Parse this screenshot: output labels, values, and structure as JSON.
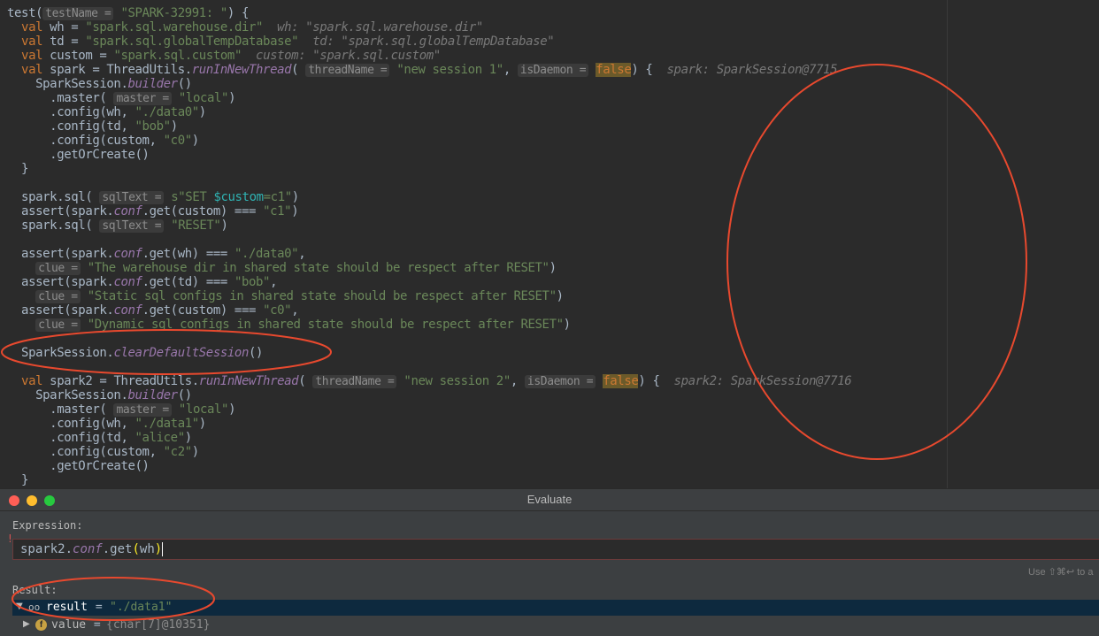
{
  "editor": {
    "lines": [
      [
        [
          "t",
          "test("
        ],
        [
          "h",
          "testName ="
        ],
        [
          "s",
          " \"SPARK-32991: \""
        ],
        [
          "t",
          ") {"
        ]
      ],
      [
        [
          "k",
          "  val"
        ],
        [
          "t",
          " wh = "
        ],
        [
          "s",
          "\"spark.sql.warehouse.dir\""
        ],
        [
          "i",
          "  wh: \"spark.sql.warehouse.dir\""
        ]
      ],
      [
        [
          "k",
          "  val"
        ],
        [
          "t",
          " td = "
        ],
        [
          "s",
          "\"spark.sql.globalTempDatabase\""
        ],
        [
          "i",
          "  td: \"spark.sql.globalTempDatabase\""
        ]
      ],
      [
        [
          "k",
          "  val"
        ],
        [
          "t",
          " custom = "
        ],
        [
          "s",
          "\"spark.sql.custom\""
        ],
        [
          "i",
          "  custom: \"spark.sql.custom\""
        ]
      ],
      [
        [
          "k",
          "  val"
        ],
        [
          "t",
          " spark = ThreadUtils."
        ],
        [
          "m",
          "runInNewThread"
        ],
        [
          "t",
          "( "
        ],
        [
          "h",
          "threadName ="
        ],
        [
          "s",
          " \"new session 1\""
        ],
        [
          "t",
          ", "
        ],
        [
          "h",
          "isDaemon ="
        ],
        [
          "t",
          " "
        ],
        [
          "fv",
          "false"
        ],
        [
          "t",
          ") {"
        ],
        [
          "i",
          "  spark: SparkSession@7715"
        ]
      ],
      [
        [
          "t",
          "    SparkSession."
        ],
        [
          "m",
          "builder"
        ],
        [
          "t",
          "()"
        ]
      ],
      [
        [
          "t",
          "      .master( "
        ],
        [
          "h",
          "master ="
        ],
        [
          "s",
          " \"local\""
        ],
        [
          "t",
          ")"
        ]
      ],
      [
        [
          "t",
          "      .config(wh, "
        ],
        [
          "s",
          "\"./data0\""
        ],
        [
          "t",
          ")"
        ]
      ],
      [
        [
          "t",
          "      .config(td, "
        ],
        [
          "s",
          "\"bob\""
        ],
        [
          "t",
          ")"
        ]
      ],
      [
        [
          "t",
          "      .config(custom, "
        ],
        [
          "s",
          "\"c0\""
        ],
        [
          "t",
          ")"
        ]
      ],
      [
        [
          "t",
          "      .getOrCreate()"
        ]
      ],
      [
        [
          "t",
          "  }"
        ]
      ],
      [
        [
          "t",
          ""
        ]
      ],
      [
        [
          "t",
          "  spark.sql( "
        ],
        [
          "h",
          "sqlText ="
        ],
        [
          "t",
          " "
        ],
        [
          "s",
          "s\"SET "
        ],
        [
          "sv",
          "$custom"
        ],
        [
          "s",
          "=c1\""
        ],
        [
          "t",
          ")"
        ]
      ],
      [
        [
          "t",
          "  assert(spark."
        ],
        [
          "f",
          "conf"
        ],
        [
          "t",
          ".get(custom) === "
        ],
        [
          "s",
          "\"c1\""
        ],
        [
          "t",
          ")"
        ]
      ],
      [
        [
          "t",
          "  spark.sql( "
        ],
        [
          "h",
          "sqlText ="
        ],
        [
          "s",
          " \"RESET\""
        ],
        [
          "t",
          ")"
        ]
      ],
      [
        [
          "t",
          ""
        ]
      ],
      [
        [
          "t",
          "  assert(spark."
        ],
        [
          "f",
          "conf"
        ],
        [
          "t",
          ".get(wh) === "
        ],
        [
          "s",
          "\"./data0\""
        ],
        [
          "t",
          ","
        ]
      ],
      [
        [
          "t",
          "    "
        ],
        [
          "h",
          "clue ="
        ],
        [
          "s",
          " \"The warehouse dir in shared state should be respect after RESET\""
        ],
        [
          "t",
          ")"
        ]
      ],
      [
        [
          "t",
          "  assert(spark."
        ],
        [
          "f",
          "conf"
        ],
        [
          "t",
          ".get(td) === "
        ],
        [
          "s",
          "\"bob\""
        ],
        [
          "t",
          ","
        ]
      ],
      [
        [
          "t",
          "    "
        ],
        [
          "h",
          "clue ="
        ],
        [
          "s",
          " \"Static sql configs in shared state should be respect after RESET\""
        ],
        [
          "t",
          ")"
        ]
      ],
      [
        [
          "t",
          "  assert(spark."
        ],
        [
          "f",
          "conf"
        ],
        [
          "t",
          ".get(custom) === "
        ],
        [
          "s",
          "\"c0\""
        ],
        [
          "t",
          ","
        ]
      ],
      [
        [
          "t",
          "    "
        ],
        [
          "h",
          "clue ="
        ],
        [
          "s",
          " \"Dynamic sql configs in shared state should be respect after RESET\""
        ],
        [
          "t",
          ")"
        ]
      ],
      [
        [
          "t",
          ""
        ]
      ],
      [
        [
          "t",
          "  SparkSession."
        ],
        [
          "m",
          "clearDefaultSession"
        ],
        [
          "t",
          "()"
        ]
      ],
      [
        [
          "t",
          ""
        ]
      ],
      [
        [
          "k",
          "  val"
        ],
        [
          "t",
          " spark2 = ThreadUtils."
        ],
        [
          "m",
          "runInNewThread"
        ],
        [
          "t",
          "( "
        ],
        [
          "h",
          "threadName ="
        ],
        [
          "s",
          " \"new session 2\""
        ],
        [
          "t",
          ", "
        ],
        [
          "h",
          "isDaemon ="
        ],
        [
          "t",
          " "
        ],
        [
          "fv",
          "false"
        ],
        [
          "t",
          ") {"
        ],
        [
          "i",
          "  spark2: SparkSession@7716"
        ]
      ],
      [
        [
          "t",
          "    SparkSession."
        ],
        [
          "m",
          "builder"
        ],
        [
          "t",
          "()"
        ]
      ],
      [
        [
          "t",
          "      .master( "
        ],
        [
          "h",
          "master ="
        ],
        [
          "s",
          " \"local\""
        ],
        [
          "t",
          ")"
        ]
      ],
      [
        [
          "t",
          "      .config(wh, "
        ],
        [
          "s",
          "\"./data1\""
        ],
        [
          "t",
          ")"
        ]
      ],
      [
        [
          "t",
          "      .config(td, "
        ],
        [
          "s",
          "\"alice\""
        ],
        [
          "t",
          ")"
        ]
      ],
      [
        [
          "t",
          "      .config(custom, "
        ],
        [
          "s",
          "\"c2\""
        ],
        [
          "t",
          ")"
        ]
      ],
      [
        [
          "t",
          "      .getOrCreate()"
        ]
      ],
      [
        [
          "t",
          "  }"
        ]
      ]
    ]
  },
  "evaluate": {
    "title": "Evaluate",
    "expression_label": "Expression:",
    "expression_parts": {
      "a": "spark2.",
      "b": "conf",
      "c": ".get",
      "d": "(",
      "e": "wh",
      "f": ")"
    },
    "shortcut_hint": "Use ⇧⌘↩ to a",
    "result_label": "Result:",
    "result_name": "result",
    "result_eq": " = ",
    "result_value": "\"./data1\"",
    "value_name": "value",
    "value_eq": " = ",
    "value_value": "{char[7]@10351}"
  },
  "colors": {
    "annotation": "#e8492e",
    "keyword": "#cc7832",
    "string": "#6a8759"
  }
}
